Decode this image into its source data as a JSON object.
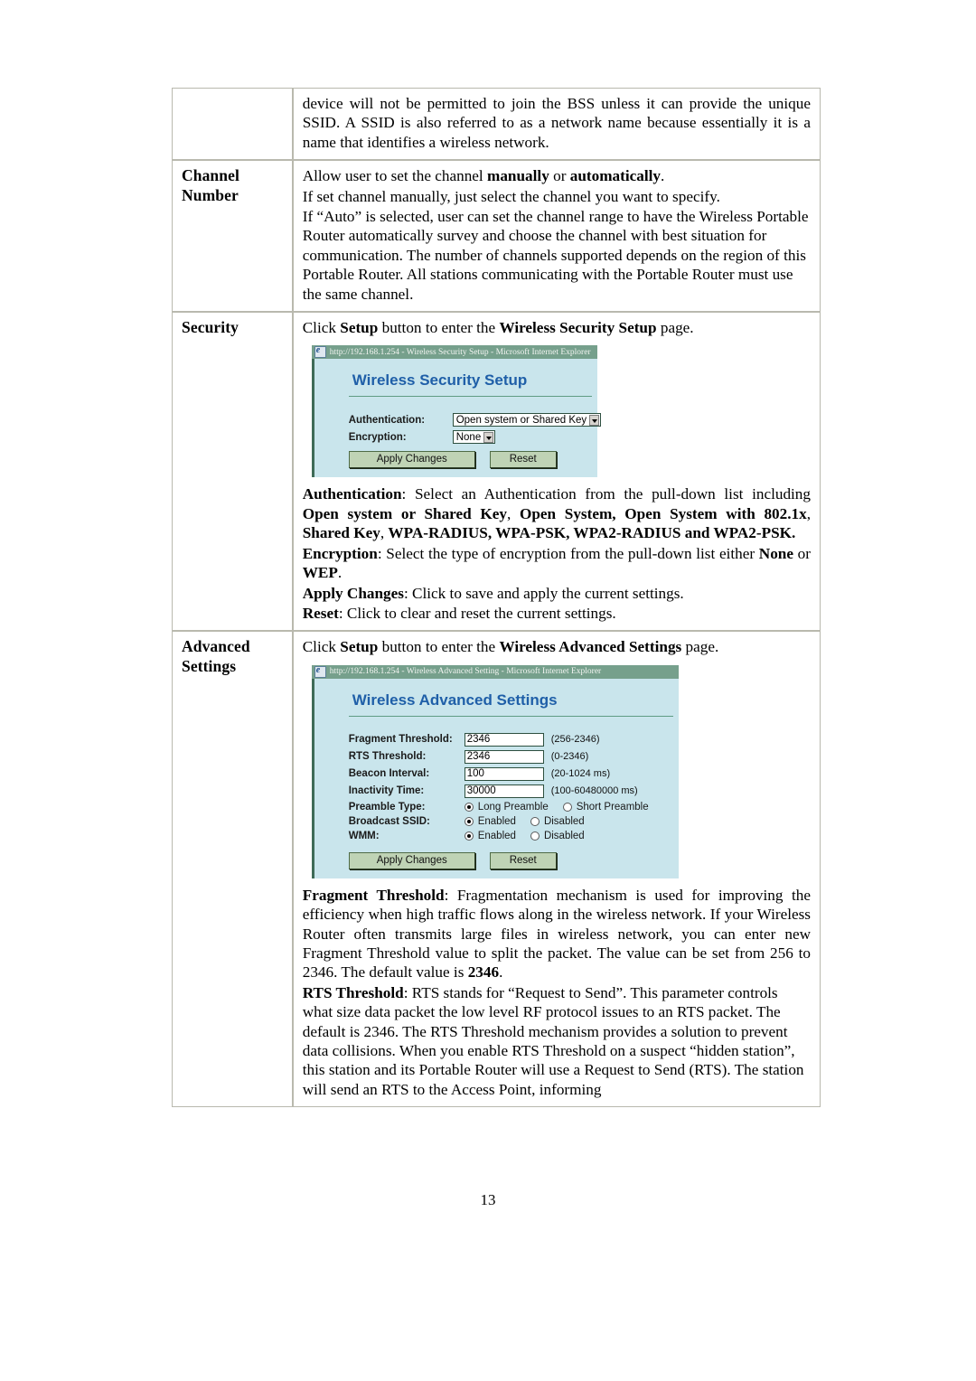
{
  "page": {
    "number": "13"
  },
  "table": {
    "rows": [
      {
        "label": "",
        "label2": "",
        "paragraphs": [
          "device will not be permitted to join the BSS unless it can provide the unique SSID. A SSID is also referred to as a network name because essentially it is a name that identifies a wireless network."
        ]
      },
      {
        "label": "Channel",
        "label2": "Number"
      },
      {
        "label": "Security",
        "label2": ""
      },
      {
        "label": "Advanced",
        "label2": "Settings"
      }
    ]
  },
  "channel_number": {
    "line1_a": "Allow user to set the channel ",
    "line1_b": "manually",
    "line1_c": " or ",
    "line1_d": "automatically",
    "line1_e": ".",
    "line2": "If set channel manually, just select the channel you want to specify.",
    "line3": "If “Auto” is selected, user can set the channel range to have the Wireless Portable Router automatically survey and choose the channel with best situation for communication. The number of channels supported depends on the region of this Portable Router. All stations communicating with the Portable Router must use the same channel."
  },
  "security": {
    "intro": {
      "a": "Click ",
      "b": "Setup",
      "c": " button to enter the ",
      "d": "Wireless Security Setup",
      "e": " page."
    },
    "window": {
      "title": "http://192.168.1.254 - Wireless Security Setup - Microsoft Internet Explorer",
      "heading": "Wireless Security Setup",
      "fields": {
        "authentication_label": "Authentication:",
        "authentication_value": "Open system or Shared Key",
        "encryption_label": "Encryption:",
        "encryption_value": "None"
      },
      "buttons": {
        "apply": "Apply Changes",
        "reset": "Reset"
      }
    },
    "descriptions": [
      {
        "term": "Authentication",
        "text_a": ": Select an Authentication from the pull-down list including ",
        "bold_list": "Open system or Shared Key",
        "text_b": ", ",
        "bold_list2": "Open System, Open System with 802.1x",
        "text_c": ", ",
        "bold_list3": "Shared Key",
        "text_d": ", ",
        "bold_list4": "WPA-RADIUS, WPA-PSK, WPA2-RADIUS and WPA2-PSK."
      },
      {
        "term": "Encryption",
        "text_a": ": Select the type of encryption from the pull-down list either ",
        "bold_list": "None",
        "text_b": " or ",
        "bold_list2": "WEP",
        "text_c": "."
      },
      {
        "term": "Apply Changes",
        "text_a": ": Click to save and apply the current settings."
      },
      {
        "term": "Reset",
        "text_a": ": Click to clear and reset the current settings."
      }
    ]
  },
  "advanced": {
    "intro": {
      "a": "Click ",
      "b": "Setup",
      "c": " button to enter the ",
      "d": "Wireless Advanced Settings",
      "e": " page."
    },
    "window": {
      "title": "http://192.168.1.254 - Wireless Advanced Setting - Microsoft Internet Explorer",
      "heading": "Wireless Advanced Settings",
      "fields": [
        {
          "label": "Fragment Threshold:",
          "value": "2346",
          "hint": "(256-2346)"
        },
        {
          "label": "RTS Threshold:",
          "value": "2346",
          "hint": "(0-2346)"
        },
        {
          "label": "Beacon Interval:",
          "value": "100",
          "hint": "(20-1024 ms)"
        },
        {
          "label": "Inactivity Time:",
          "value": "30000",
          "hint": "(100-60480000 ms)"
        }
      ],
      "radios": [
        {
          "label": "Preamble Type:",
          "options": [
            {
              "text": "Long Preamble",
              "selected": true
            },
            {
              "text": "Short Preamble",
              "selected": false
            }
          ]
        },
        {
          "label": "Broadcast SSID:",
          "options": [
            {
              "text": "Enabled",
              "selected": true
            },
            {
              "text": "Disabled",
              "selected": false
            }
          ]
        },
        {
          "label": "WMM:",
          "options": [
            {
              "text": "Enabled",
              "selected": true
            },
            {
              "text": "Disabled",
              "selected": false
            }
          ]
        }
      ],
      "buttons": {
        "apply": "Apply Changes",
        "reset": "Reset"
      }
    },
    "descriptions": [
      {
        "term": "Fragment Threshold",
        "text_a": ": Fragmentation mechanism is used for improving the efficiency when high traffic flows along in the wireless network. If your Wireless Router often transmits large files in wireless network, you can enter new Fragment Threshold value to split the packet.  The value can be set from 256 to 2346. The default value is ",
        "bold_tail": "2346",
        "text_b": "."
      },
      {
        "term": "RTS Threshold",
        "text_a": ": RTS stands for “Request to Send”. This parameter controls what size data packet the low level RF protocol issues to an RTS packet. The default is 2346. The RTS Threshold mechanism provides a solution to prevent data collisions. When you enable RTS Threshold on a suspect “hidden station”, this station and its Portable Router will use a Request to Send (RTS). The station will send an RTS to the Access Point, informing"
      }
    ]
  },
  "colors": {
    "ie_titlebar": "#76a08c",
    "ie_body": "#c9e5ec",
    "ie_heading_text": "#1f5fa8",
    "ie_button": "#bfd3b5",
    "table_border": "#b9b9ae"
  }
}
